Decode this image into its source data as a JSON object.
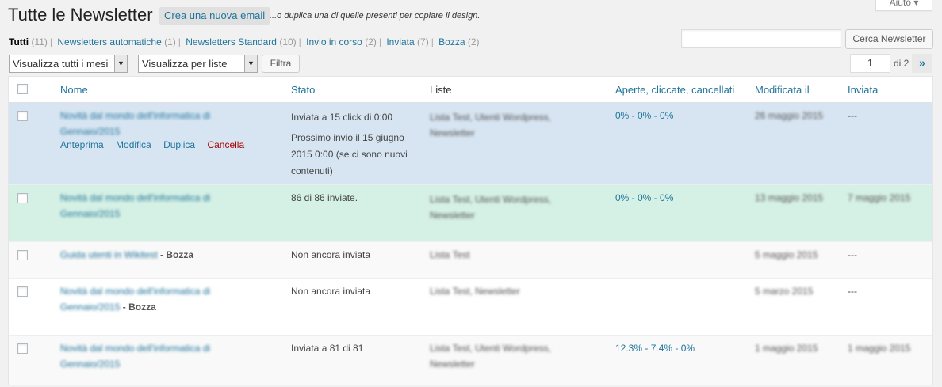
{
  "help": {
    "label": "Aiuto"
  },
  "header": {
    "title": "Tutte le Newsletter",
    "add_new": "Crea una nuova email",
    "dup_note": "...o duplica una di quelle presenti per copiare il design."
  },
  "views": [
    {
      "label": "Tutti",
      "count": "(11)"
    },
    {
      "label": "Newsletters automatiche",
      "count": "(1)"
    },
    {
      "label": "Newsletters Standard",
      "count": "(10)"
    },
    {
      "label": "Invio in corso",
      "count": "(2)"
    },
    {
      "label": "Inviata",
      "count": "(7)"
    },
    {
      "label": "Bozza",
      "count": "(2)"
    }
  ],
  "search": {
    "value": "",
    "button": "Cerca Newsletter"
  },
  "filters": {
    "months": "Visualizza tutti i mesi",
    "lists": "Visualizza per liste",
    "filter_btn": "Filtra"
  },
  "pagination": {
    "current": "1",
    "of": "di 2",
    "next": "»"
  },
  "columns": {
    "name": "Nome",
    "status": "Stato",
    "lists": "Liste",
    "stats": "Aperte, cliccate, cancellati",
    "modified": "Modificata il",
    "sent": "Inviata"
  },
  "rows": [
    {
      "name": "Novità dal mondo dell'informatica di Gennaio/2015",
      "draft": "",
      "status": "Inviata a 15 click di 0:00",
      "status2": "Prossimo invio il 15 giugno 2015 0:00 (se ci sono nuovi contenuti)",
      "lists": "Lista Test, Utenti Wordpress, Newsletter",
      "stats": "0% - 0% - 0%",
      "modified": "26 maggio 2015",
      "sent": "---",
      "actions": {
        "preview": "Anteprima",
        "edit": "Modifica",
        "duplicate": "Duplica",
        "delete": "Cancella"
      }
    },
    {
      "name": "Novità dal mondo dell'informatica di Gennaio/2015",
      "draft": "",
      "status": "86 di 86 inviate.",
      "lists": "Lista Test, Utenti Wordpress, Newsletter",
      "stats": "0% - 0% - 0%",
      "modified": "13 maggio 2015",
      "sent": "7 maggio 2015"
    },
    {
      "name": "Guida utenti in Wikitest",
      "draft": " - Bozza",
      "status": "Non ancora inviata",
      "lists": "Lista Test",
      "stats": "",
      "modified": "5 maggio 2015",
      "sent": "---"
    },
    {
      "name": "Novità dal mondo dell'informatica di Gennaio/2015",
      "draft": " - Bozza",
      "status": "Non ancora inviata",
      "lists": "Lista Test, Newsletter",
      "stats": "",
      "modified": "5 marzo 2015",
      "sent": "---"
    },
    {
      "name": "Novità dal mondo dell'informatica di Gennaio/2015",
      "draft": "",
      "status": "Inviata a 81 di 81",
      "lists": "Lista Test, Utenti Wordpress, Newsletter",
      "stats": "12.3% - 7.4% - 0%",
      "modified": "1 maggio 2015",
      "sent": "1 maggio 2015"
    }
  ],
  "colors": {
    "link": "#21759b",
    "row_highlight_blue": "#d7e5f2",
    "row_highlight_green": "#d5f0e5",
    "delete": "#aa0000"
  }
}
